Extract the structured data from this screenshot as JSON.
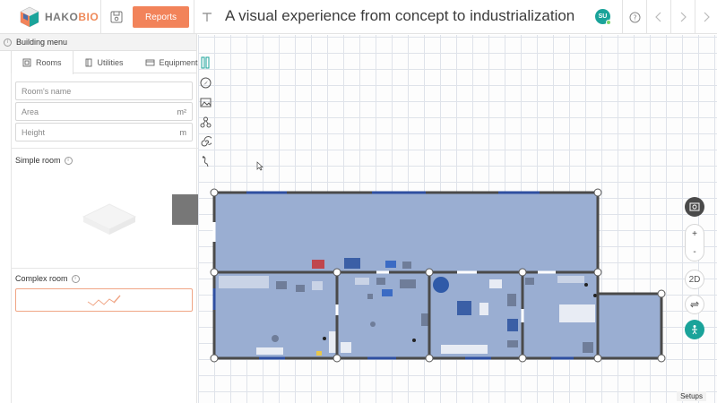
{
  "app": {
    "logo_prefix": "HAKO",
    "logo_suffix": "BIO",
    "title": "A visual experience from concept to industrialization",
    "reports_label": "Reports",
    "user_initials": "SU"
  },
  "panel": {
    "header": "Building menu",
    "tabs": [
      {
        "label": "Rooms",
        "active": true
      },
      {
        "label": "Utilities",
        "active": false
      },
      {
        "label": "Equipment",
        "active": false
      }
    ],
    "fields": {
      "name_placeholder": "Room's name",
      "area_placeholder": "Area",
      "area_unit": "m²",
      "height_placeholder": "Height",
      "height_unit": "m"
    },
    "simple_room_label": "Simple room",
    "complex_room_label": "Complex room"
  },
  "canvas": {
    "view_toggle_label": "2D",
    "zoom_in": "+",
    "zoom_out": "-",
    "setups_label": "Setups"
  },
  "colors": {
    "accent": "#f2835a",
    "teal": "#1aa39a",
    "room_fill": "#9aaed2",
    "wall": "#4a4a4a",
    "door": "#2f4fa0"
  }
}
